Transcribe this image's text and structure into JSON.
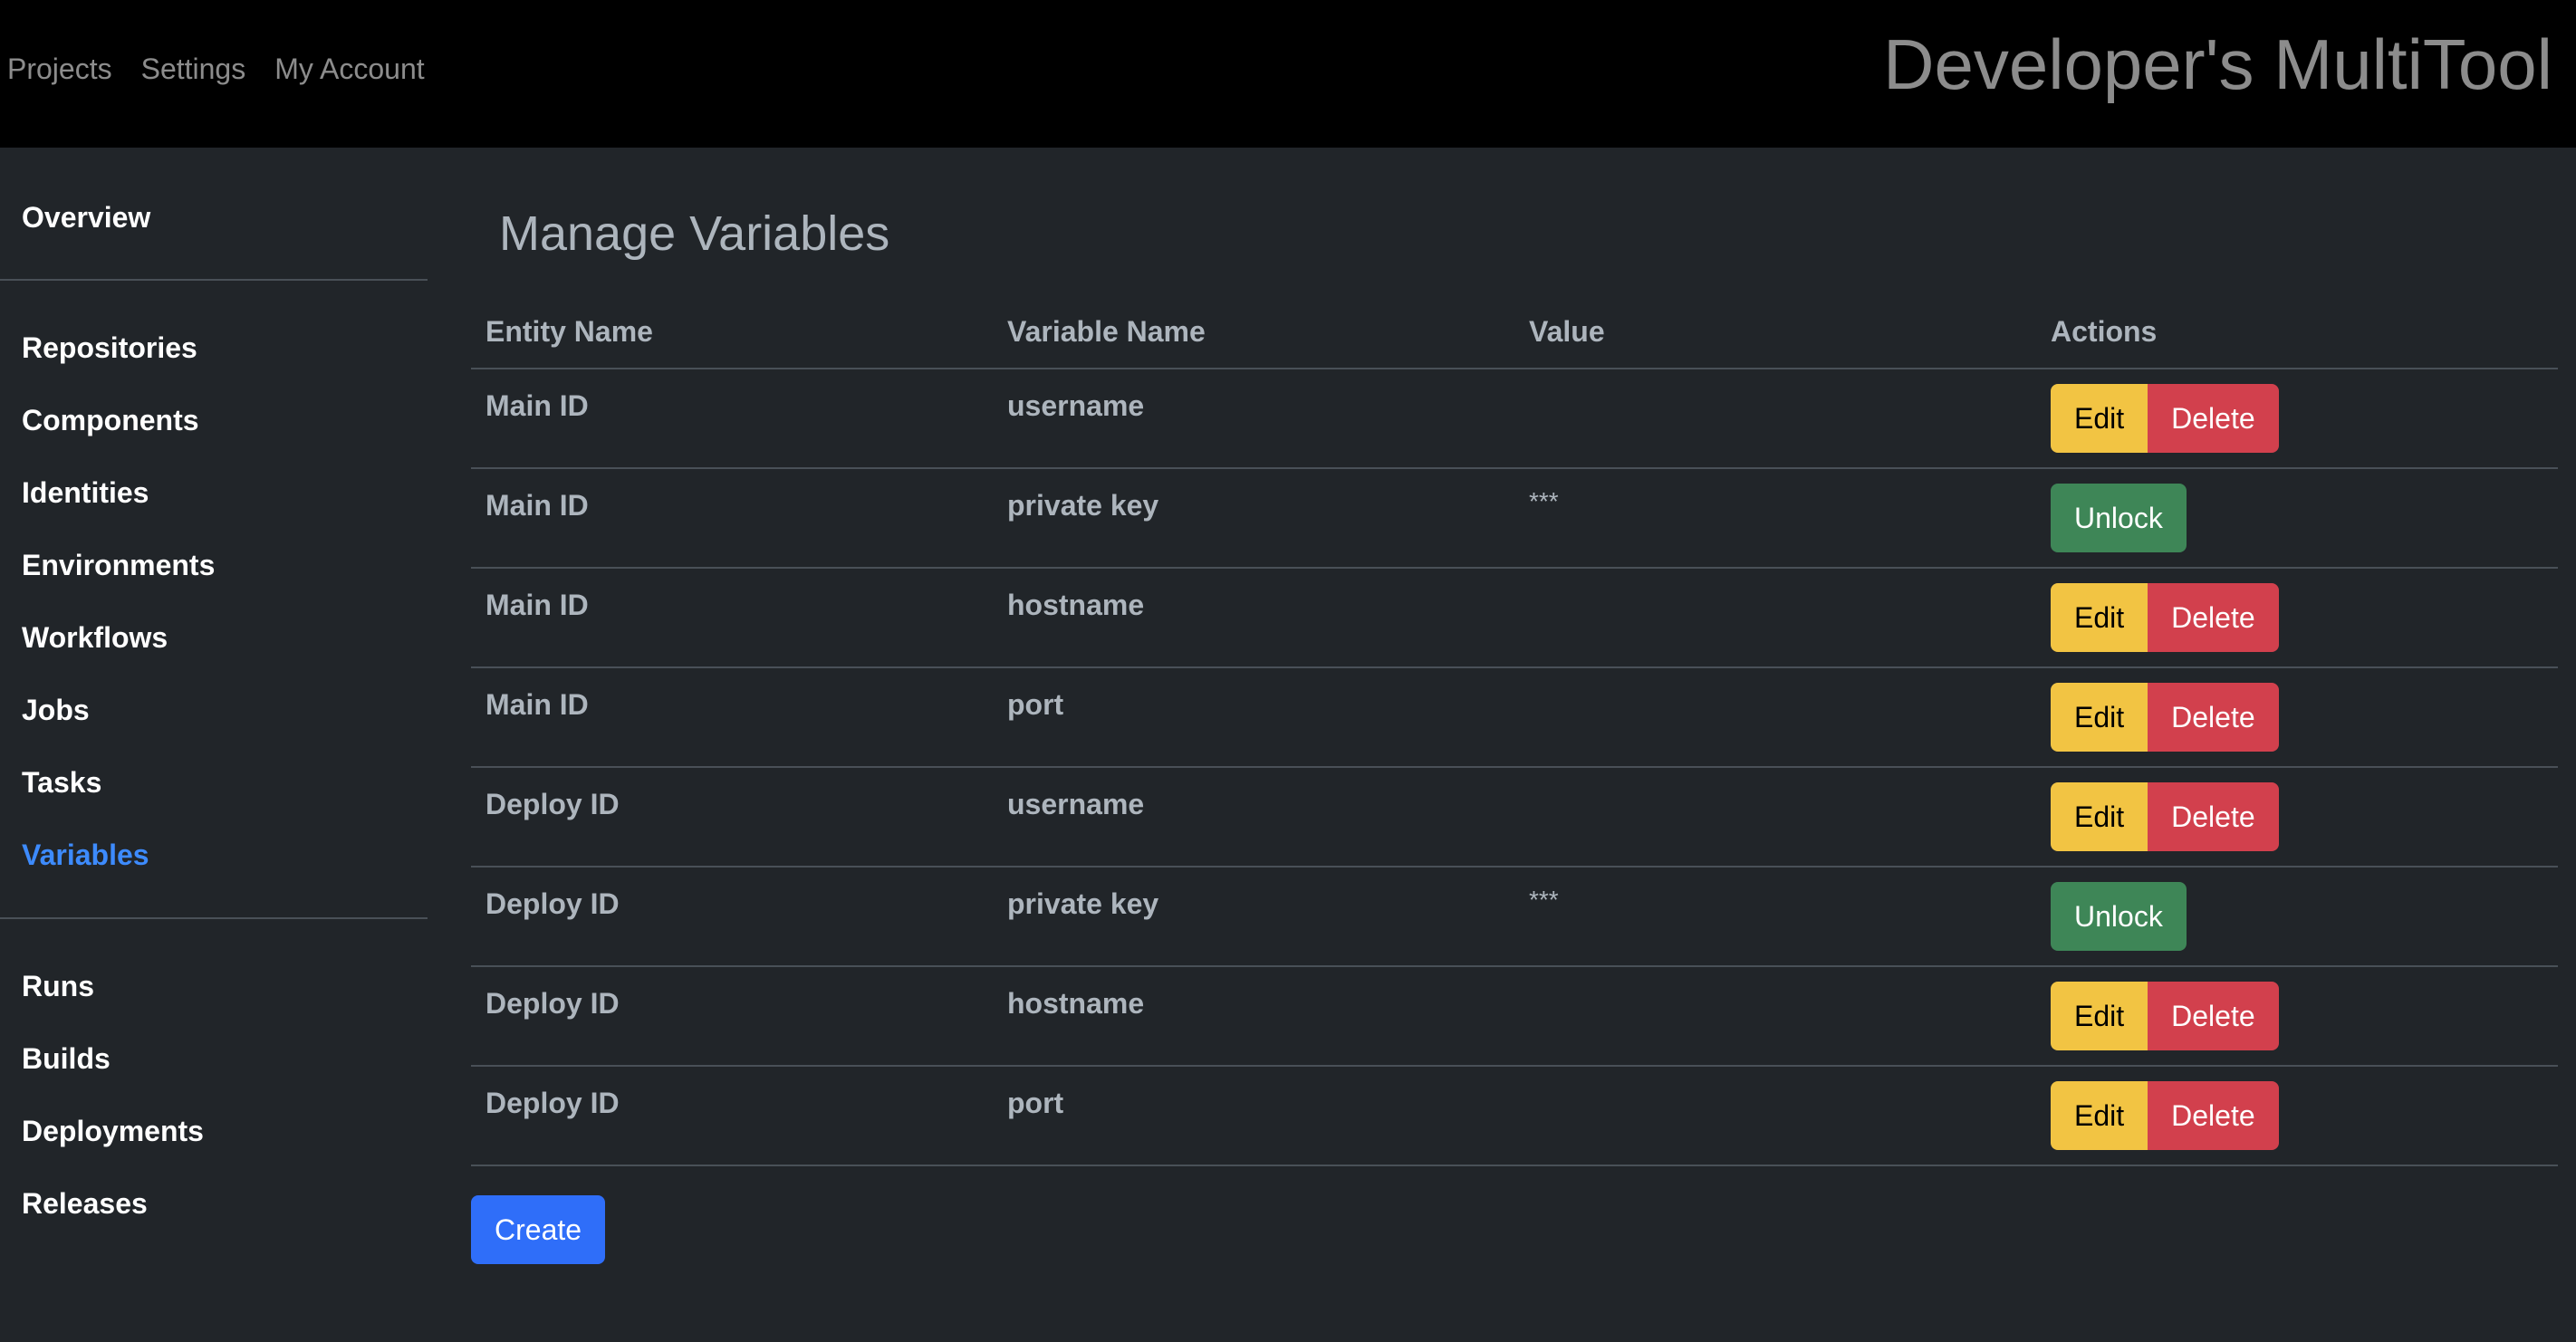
{
  "header": {
    "nav": [
      "Projects",
      "Settings",
      "My Account"
    ],
    "brand": "Developer's MultiTool"
  },
  "sidebar": {
    "groups": [
      [
        "Overview"
      ],
      [
        "Repositories",
        "Components",
        "Identities",
        "Environments",
        "Workflows",
        "Jobs",
        "Tasks",
        "Variables"
      ],
      [
        "Runs",
        "Builds",
        "Deployments",
        "Releases"
      ]
    ],
    "active": "Variables"
  },
  "main": {
    "title": "Manage Variables",
    "columns": [
      "Entity Name",
      "Variable Name",
      "Value",
      "Actions"
    ],
    "rows": [
      {
        "entity": "Main ID",
        "variable": "username",
        "value": "",
        "actions": [
          "Edit",
          "Delete"
        ]
      },
      {
        "entity": "Main ID",
        "variable": "private key",
        "value": "***",
        "actions": [
          "Unlock"
        ]
      },
      {
        "entity": "Main ID",
        "variable": "hostname",
        "value": "",
        "actions": [
          "Edit",
          "Delete"
        ]
      },
      {
        "entity": "Main ID",
        "variable": "port",
        "value": "",
        "actions": [
          "Edit",
          "Delete"
        ]
      },
      {
        "entity": "Deploy ID",
        "variable": "username",
        "value": "",
        "actions": [
          "Edit",
          "Delete"
        ]
      },
      {
        "entity": "Deploy ID",
        "variable": "private key",
        "value": "***",
        "actions": [
          "Unlock"
        ]
      },
      {
        "entity": "Deploy ID",
        "variable": "hostname",
        "value": "",
        "actions": [
          "Edit",
          "Delete"
        ]
      },
      {
        "entity": "Deploy ID",
        "variable": "port",
        "value": "",
        "actions": [
          "Edit",
          "Delete"
        ]
      }
    ],
    "create_label": "Create"
  },
  "colors": {
    "edit": "#f2c443",
    "delete": "#d2404d",
    "unlock": "#3e8657",
    "create": "#2f6ef9",
    "active_link": "#3d8bfd"
  }
}
